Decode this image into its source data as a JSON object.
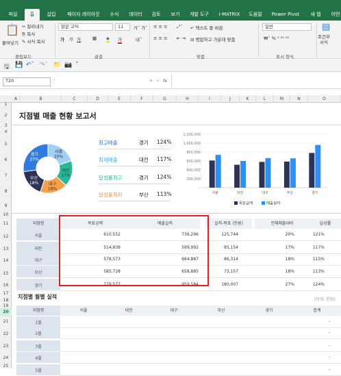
{
  "tabs": [
    "파일",
    "홈",
    "삽입",
    "페이지 레이아웃",
    "수식",
    "데이터",
    "검토",
    "보기",
    "개발 도구",
    "i-MATRIX",
    "도움말",
    "Power Pivot",
    "새 탭",
    "어떤"
  ],
  "ribbon": {
    "paste": "붙여넣기",
    "cut": "잘라내기",
    "copy": "복사",
    "format_painter": "서식 복사",
    "font_name": "맑은 고딕",
    "font_size": "11",
    "wrap": "텍스트 줄 바꿈",
    "merge": "병합하고 가운데 맞춤",
    "number_format": "일반",
    "cond_format": "조건부\n서식",
    "groups": {
      "clipboard": "클립보드",
      "font": "글꼴",
      "align": "맞춤",
      "number": "표시 형식"
    }
  },
  "formula_bar": {
    "name_box": "T20",
    "fx": "fx",
    "value": ""
  },
  "columns": [
    "A",
    "B",
    "C",
    "D",
    "E",
    "F",
    "G",
    "H",
    "I",
    "J",
    "K",
    "L",
    "M",
    "N",
    "O"
  ],
  "rows": [
    "1",
    "2",
    "3",
    "4",
    "5",
    "6",
    "7",
    "8",
    "9",
    "10",
    "11",
    "12",
    "13",
    "14",
    "15",
    "16",
    "17",
    "18",
    "19",
    "20",
    "21",
    "22",
    "23",
    "24",
    "25"
  ],
  "report_title": "지점별 매출 현황 보고서",
  "kpi": [
    {
      "label": "최고매출",
      "branch": "경기",
      "pct": "124%",
      "color": "#2e6fd9"
    },
    {
      "label": "최저매출",
      "branch": "대전",
      "pct": "117%",
      "color": "#3aa6e8"
    },
    {
      "label": "달성률최고",
      "branch": "경기",
      "pct": "124%",
      "color": "#2bb89a"
    },
    {
      "label": "달성률최저",
      "branch": "부산",
      "pct": "113%",
      "color": "#f0953a"
    }
  ],
  "donut": [
    {
      "name": "서울",
      "pct": "20%",
      "share": 20,
      "color": "#9fd0f5"
    },
    {
      "name": "대전",
      "pct": "17%",
      "share": 17,
      "color": "#2bb89a"
    },
    {
      "name": "대구",
      "pct": "18%",
      "share": 18,
      "color": "#f5a04a"
    },
    {
      "name": "부산",
      "pct": "18%",
      "share": 18,
      "color": "#2c3357"
    },
    {
      "name": "경기",
      "pct": "27%",
      "share": 27,
      "color": "#2f7be0"
    }
  ],
  "chart_data": {
    "type": "bar",
    "categories": [
      "서울",
      "대전",
      "대구",
      "부산",
      "경기"
    ],
    "series": [
      {
        "name": "목표금액",
        "values": [
          610552,
          514838,
          578573,
          585728,
          779577
        ],
        "color": "#2c3357"
      },
      {
        "name": "매출실적",
        "values": [
          736296,
          599992,
          664887,
          658885,
          959584
        ],
        "color": "#2f8ff0"
      }
    ],
    "yticks": [
      "1,200,000",
      "1,000,000",
      "800,000",
      "600,000",
      "400,000",
      "200,000",
      "-"
    ],
    "ylim": [
      0,
      1200000
    ],
    "legend": "bottom"
  },
  "table": {
    "headers": [
      "지점명",
      "목표금액",
      "매출실적",
      "실적-목표 (천원)",
      "전체매출대비",
      "달성률"
    ],
    "rows": [
      [
        "서울",
        "610,552",
        "736,296",
        "125,744",
        "20%",
        "121%"
      ],
      [
        "대전",
        "514,838",
        "599,992",
        "85,154",
        "17%",
        "117%"
      ],
      [
        "대구",
        "578,573",
        "664,887",
        "86,314",
        "18%",
        "115%"
      ],
      [
        "부산",
        "585,728",
        "658,885",
        "73,157",
        "18%",
        "113%"
      ],
      [
        "경기",
        "779,577",
        "959,584",
        "180,007",
        "27%",
        "124%"
      ]
    ]
  },
  "monthly": {
    "title": "지점별 월별 실적",
    "unit": "(단위: 천원)",
    "headers": [
      "지점명",
      "서울",
      "대전",
      "대구",
      "부산",
      "경기",
      "합계"
    ],
    "months": [
      "1월",
      "2월",
      "3월",
      "4월",
      "5월"
    ],
    "dash": "-"
  },
  "colors": {
    "excel_green": "#217346",
    "highlight_red": "#e02020"
  }
}
